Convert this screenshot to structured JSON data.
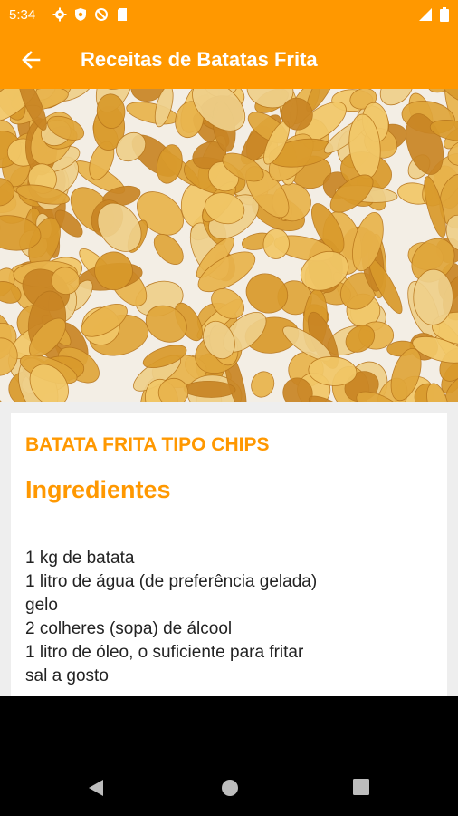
{
  "status_bar": {
    "time": "5:34",
    "icons": [
      "gear-icon",
      "shield-icon",
      "no-sync-icon",
      "sd-card-icon"
    ],
    "right_icons": [
      "signal-icon",
      "battery-icon"
    ]
  },
  "app_bar": {
    "title": "Receitas de Batatas Frita",
    "back_icon": "arrow-left-icon",
    "background": "#ff9800"
  },
  "recipe": {
    "image": "potato-chips-photo",
    "title": "BATATA FRITA TIPO CHIPS",
    "ingredients_heading": "Ingredientes",
    "ingredients": [
      "1 kg de batata",
      "1 litro de água (de preferência gelada)",
      "gelo",
      "2 colheres (sopa) de álcool",
      "1 litro de óleo, o suficiente para fritar",
      "sal a gosto"
    ],
    "accent_color": "#ff9800"
  },
  "nav_bar": {
    "buttons": [
      "back-triangle-icon",
      "home-circle-icon",
      "recents-square-icon"
    ]
  }
}
